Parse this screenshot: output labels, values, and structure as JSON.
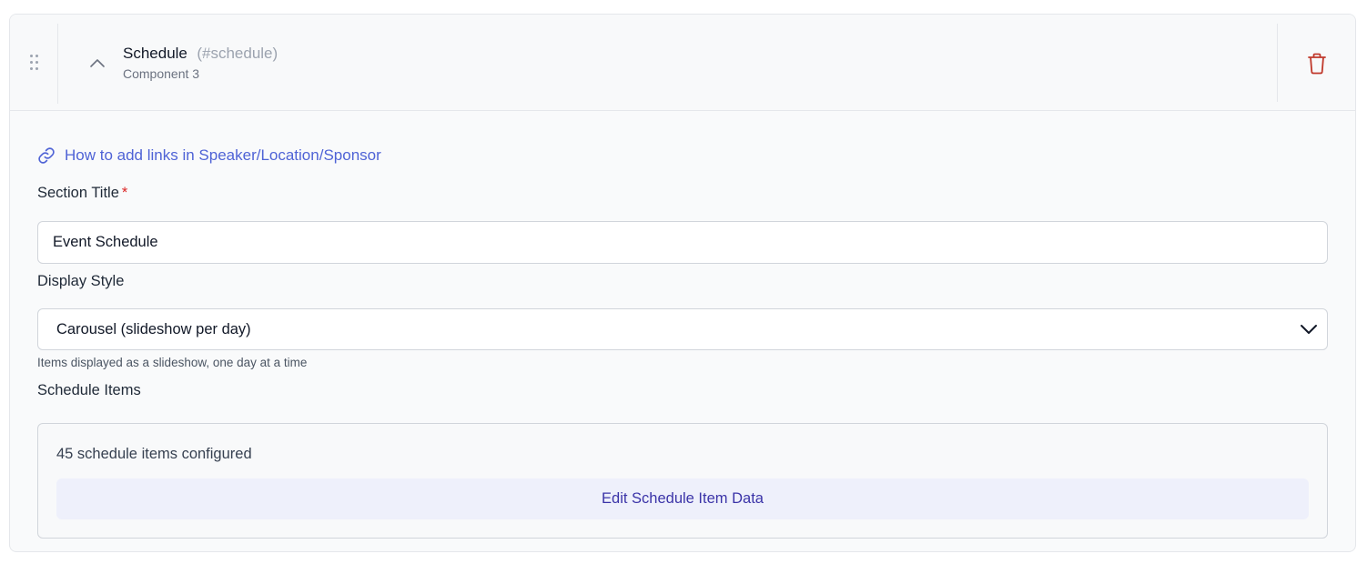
{
  "component": {
    "title": "Schedule",
    "anchor": "(#schedule)",
    "subtitle": "Component 3"
  },
  "icons": {
    "drag": "drag-dots-icon",
    "collapse": "chevron-up-icon",
    "delete": "trash-icon",
    "link": "link-icon",
    "dropdown": "chevron-down-icon"
  },
  "colors": {
    "link": "#4f63d6",
    "required": "#dc2626",
    "delete": "#c0392b",
    "button_bg": "#eef0fb",
    "button_text": "#3b34a8"
  },
  "help_link": {
    "label": "How to add links in Speaker/Location/Sponsor"
  },
  "section_title": {
    "label": "Section Title",
    "required_mark": "*",
    "value": "Event Schedule"
  },
  "display_style": {
    "label": "Display Style",
    "selected": "Carousel (slideshow per day)",
    "hint": "Items displayed as a slideshow, one day at a time"
  },
  "schedule_items": {
    "label": "Schedule Items",
    "count_text": "45 schedule items configured",
    "edit_button": "Edit Schedule Item Data"
  }
}
